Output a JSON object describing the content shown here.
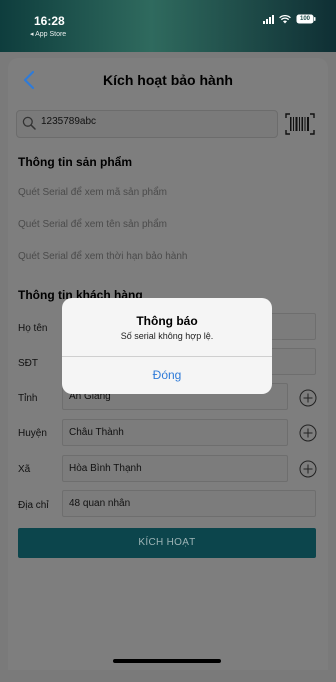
{
  "status_bar": {
    "time": "16:28",
    "back_app": "◂ App Store",
    "battery": "100"
  },
  "nav": {
    "title": "Kích hoạt bảo hành"
  },
  "search": {
    "value": "1235789abc",
    "placeholder": ""
  },
  "product": {
    "section_title": "Thông tin sản phẩm",
    "lines": [
      "Quét Serial để xem mã sản phẩm",
      "Quét Serial để xem tên sản phẩm",
      "Quét Serial để xem thời hạn bảo hành"
    ]
  },
  "customer": {
    "section_title": "Thông tin khách hàng",
    "fields": [
      {
        "label": "Họ tên",
        "value": ""
      },
      {
        "label": "SĐT",
        "value": ""
      },
      {
        "label": "Tỉnh",
        "value": "An Giang"
      },
      {
        "label": "Huyện",
        "value": "Châu Thành"
      },
      {
        "label": "Xã",
        "value": "Hòa Bình Thạnh"
      },
      {
        "label": "Địa chỉ",
        "value": "48 quan nhân"
      }
    ]
  },
  "activate_button": "KÍCH HOẠT",
  "dialog": {
    "title": "Thông báo",
    "message": "Số serial không hợp lệ.",
    "button": "Đóng"
  },
  "colors": {
    "accent": "#0c454c",
    "link": "#2f7bd8",
    "status_bar": "#2f6a5e"
  }
}
